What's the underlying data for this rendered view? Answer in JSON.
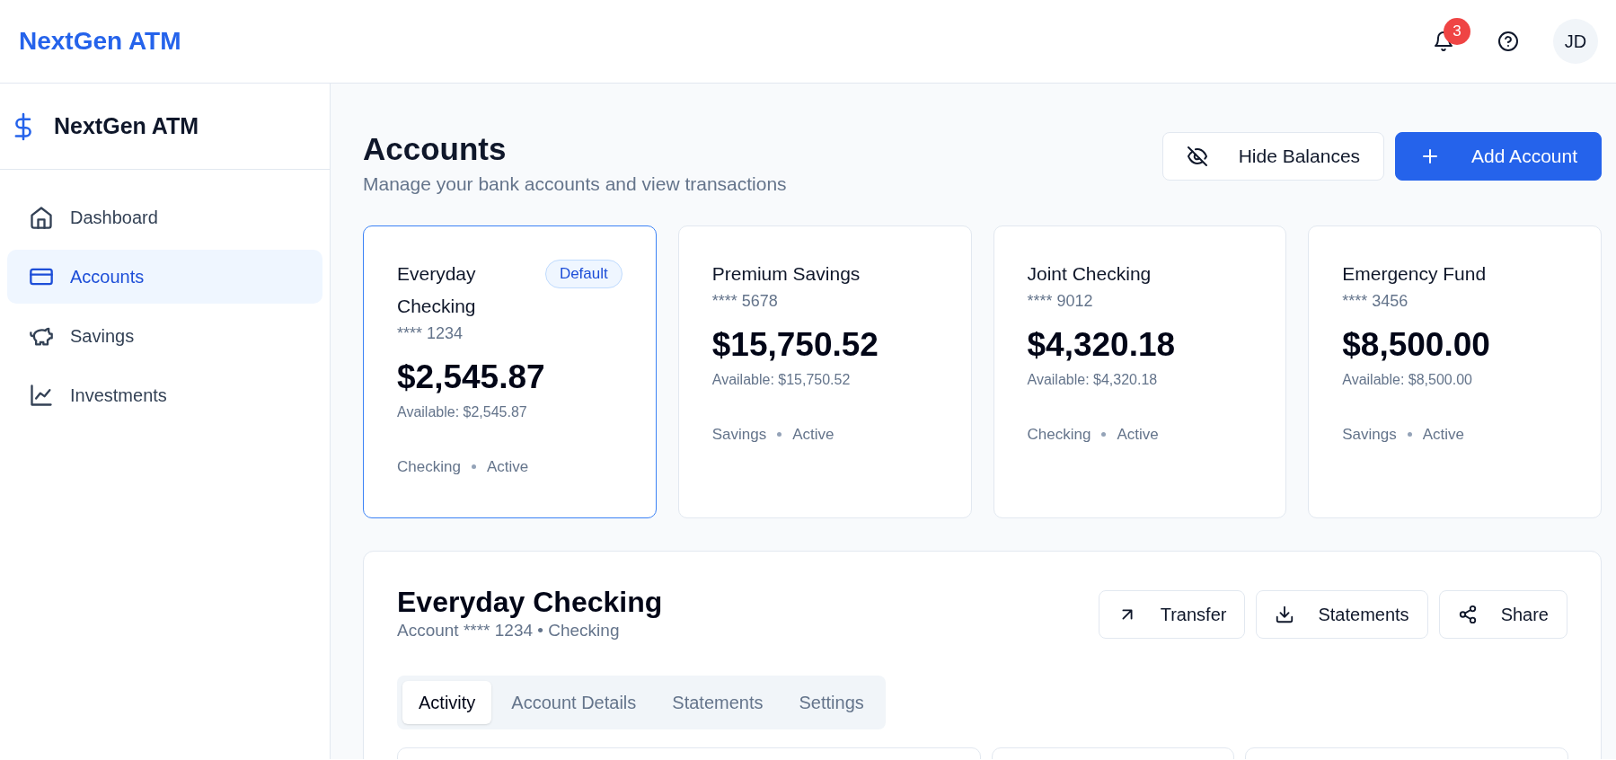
{
  "topbar": {
    "brand": "NextGen ATM",
    "notification_count": "3",
    "avatar": "JD"
  },
  "sidebar": {
    "brand": "NextGen ATM",
    "items": [
      {
        "label": "Dashboard",
        "selected": false
      },
      {
        "label": "Accounts",
        "selected": true
      },
      {
        "label": "Savings",
        "selected": false
      },
      {
        "label": "Investments",
        "selected": false
      }
    ]
  },
  "page": {
    "title": "Accounts",
    "subtitle": "Manage your bank accounts and view transactions",
    "actions": [
      {
        "label": "Hide Balances",
        "kind": "secondary"
      },
      {
        "label": "Add Account",
        "kind": "primary"
      }
    ]
  },
  "accounts": [
    {
      "name": "Everyday Checking",
      "number": "**** 1234",
      "balance": "$2,545.87",
      "available": "Available: $2,545.87",
      "type": "Checking",
      "status": "Active",
      "badge": "Default",
      "selected": true
    },
    {
      "name": "Premium Savings",
      "number": "**** 5678",
      "balance": "$15,750.52",
      "available": "Available: $15,750.52",
      "type": "Savings",
      "status": "Active",
      "selected": false
    },
    {
      "name": "Joint Checking",
      "number": "**** 9012",
      "balance": "$4,320.18",
      "available": "Available: $4,320.18",
      "type": "Checking",
      "status": "Active",
      "selected": false
    },
    {
      "name": "Emergency Fund",
      "number": "**** 3456",
      "balance": "$8,500.00",
      "available": "Available: $8,500.00",
      "type": "Savings",
      "status": "Active",
      "selected": false
    }
  ],
  "detail": {
    "title": "Everyday Checking",
    "subtitle": "Account **** 1234 • Checking",
    "actions": [
      "Transfer",
      "Statements",
      "Share"
    ],
    "tabs": [
      {
        "label": "Activity",
        "selected": true
      },
      {
        "label": "Account Details",
        "selected": false
      },
      {
        "label": "Statements",
        "selected": false
      },
      {
        "label": "Settings",
        "selected": false
      }
    ]
  }
}
